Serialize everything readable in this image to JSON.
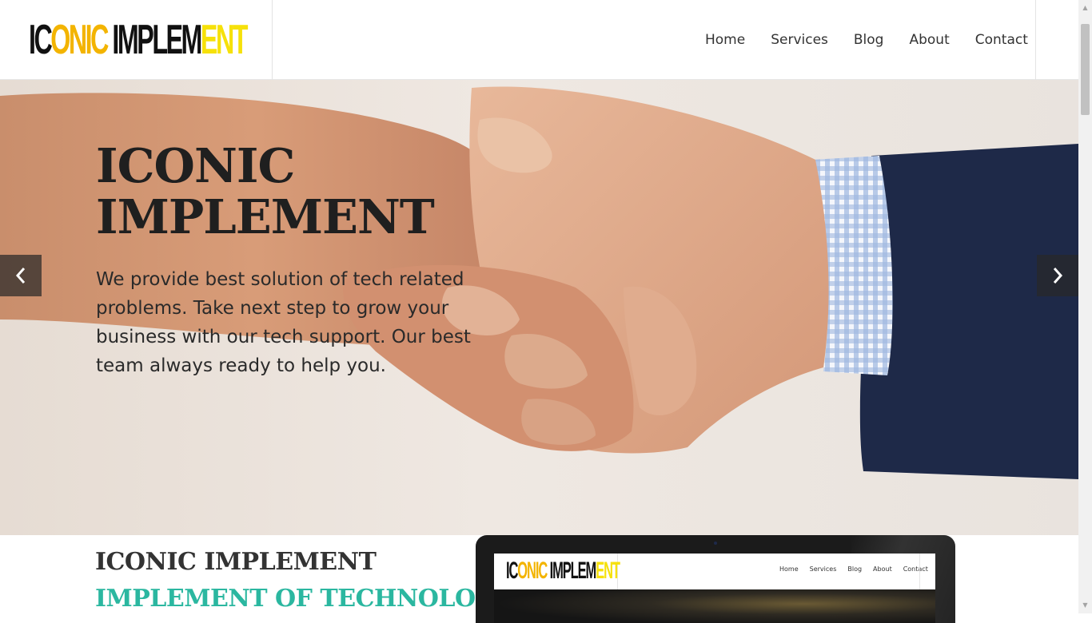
{
  "brand": {
    "logo_parts": [
      {
        "text": "IC",
        "color": "#111111"
      },
      {
        "text": "ONIC",
        "color": "#f3b400"
      },
      {
        "text": " IMPLE",
        "color": "#111111"
      },
      {
        "text": "M",
        "color": "#111111"
      },
      {
        "text": "ENT",
        "color": "#f6e10a"
      }
    ]
  },
  "nav": {
    "items": [
      "Home",
      "Services",
      "Blog",
      "About",
      "Contact"
    ]
  },
  "hero": {
    "title": "ICONIC IMPLEMENT",
    "text": "We provide best solution of tech related problems. Take next step to grow your business with our tech support. Our best team always ready to help you.",
    "prev_icon": "chevron-left-icon",
    "next_icon": "chevron-right-icon"
  },
  "section": {
    "title": "ICONIC IMPLEMENT",
    "subtitle": "IMPLEMENT OF TECHNOLOGY"
  },
  "device_preview": {
    "nav_items": [
      "Home",
      "Services",
      "Blog",
      "About",
      "Contact"
    ]
  },
  "colors": {
    "accent": "#2bb7a0",
    "logo_orange": "#f3b400",
    "logo_yellow": "#f6e10a",
    "text_dark": "#1f1f1f"
  }
}
